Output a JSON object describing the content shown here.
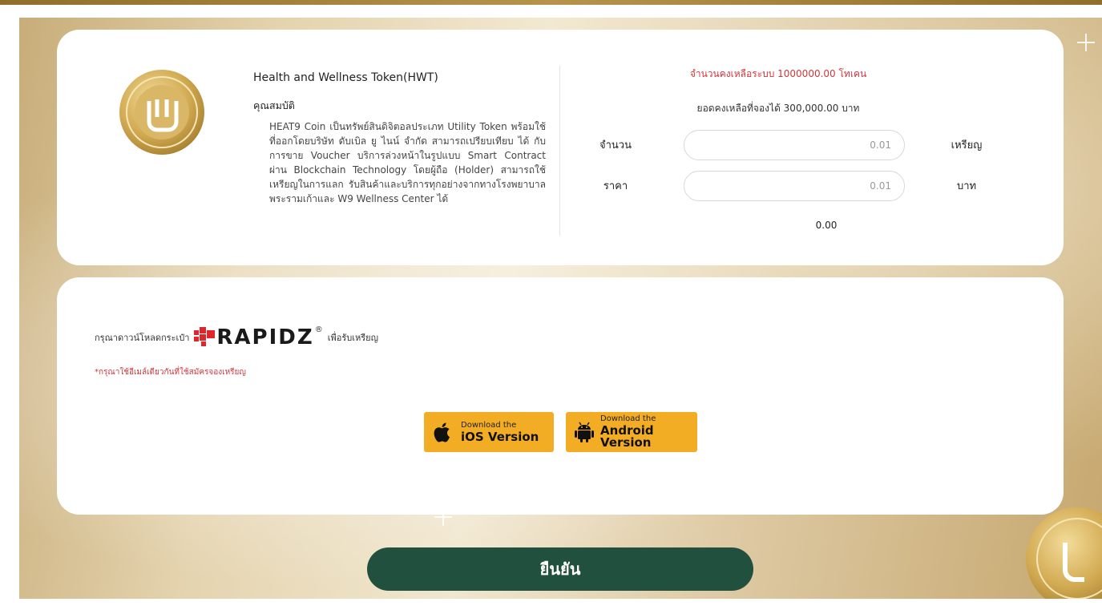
{
  "token": {
    "name": "Health and Wellness Token(HWT)",
    "properties_heading": "คุณสมบัติ",
    "description": "HEAT9 Coin เป็นทรัพย์สินดิจิตอลประเภท Utility Token พร้อมใช้ ที่ออกโดยบริษัท ดับเบิล ยู ไนน์ จำกัด สามารถเปรียบเทียบ ได้ กับการขาย Voucher บริการล่วงหน้าในรูปแบบ Smart Contract ผ่าน Blockchain Technology โดยผู้ถือ (Holder) สามารถใช้เหรียญในการแลก รับสินค้าและบริการทุกอย่างจากทางโรงพยาบาล พระรามเก้าและ W9 Wellness Center ได้"
  },
  "purchase": {
    "system_balance": "จำนวนคงเหลือระบบ 1000000.00 โทเคน",
    "reserve_balance": "ยอดคงเหลือที่จองได้ 300,000.00 บาท",
    "amount_label": "จำนวน",
    "amount_value": "0.01",
    "amount_unit": "เหรียญ",
    "price_label": "ราคา",
    "price_value": "0.01",
    "price_unit": "บาท",
    "total": "0.00"
  },
  "wallet": {
    "download_prefix": "กรุณาดาวน์โหลดกระเป๋า",
    "brand": "RAPIDZ",
    "registered": "®",
    "download_suffix": "เพื่อรับเหรียญ",
    "note": "*กรุณาใช้อีเมล์เดียวกันที่ใช้สมัครจองเหรียญ",
    "ios_small": "Download the",
    "ios_big": "iOS Version",
    "android_small": "Download the",
    "android_big": "Android Version"
  },
  "confirm_label": "ยืนยัน",
  "colors": {
    "accent_red": "#d1363a",
    "confirm_green": "#22503f",
    "store_button": "#f3ad25",
    "gold": "#c9a24c"
  },
  "icons": [
    "coin-logo-icon",
    "apple-icon",
    "android-icon",
    "rapidz-logo-icon"
  ]
}
